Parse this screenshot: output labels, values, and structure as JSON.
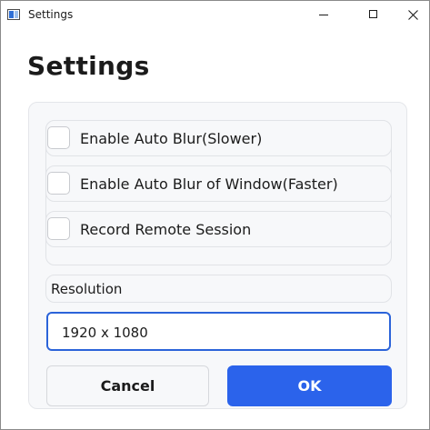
{
  "window": {
    "title": "Settings",
    "controls": {
      "minimize": "minimize-icon",
      "maximize": "maximize-icon",
      "close": "close-icon"
    }
  },
  "page": {
    "heading": "Settings"
  },
  "options": [
    {
      "label": "Enable Auto Blur(Slower)",
      "checked": false
    },
    {
      "label": "Enable Auto Blur of Window(Faster)",
      "checked": false
    },
    {
      "label": "Record Remote Session",
      "checked": false
    }
  ],
  "resolution": {
    "label": "Resolution",
    "value": "1920 x 1080"
  },
  "buttons": {
    "cancel": "Cancel",
    "ok": "OK"
  },
  "colors": {
    "accent": "#2b63eb",
    "focus_border": "#2b63d9",
    "panel_bg": "#f7f8fa"
  }
}
